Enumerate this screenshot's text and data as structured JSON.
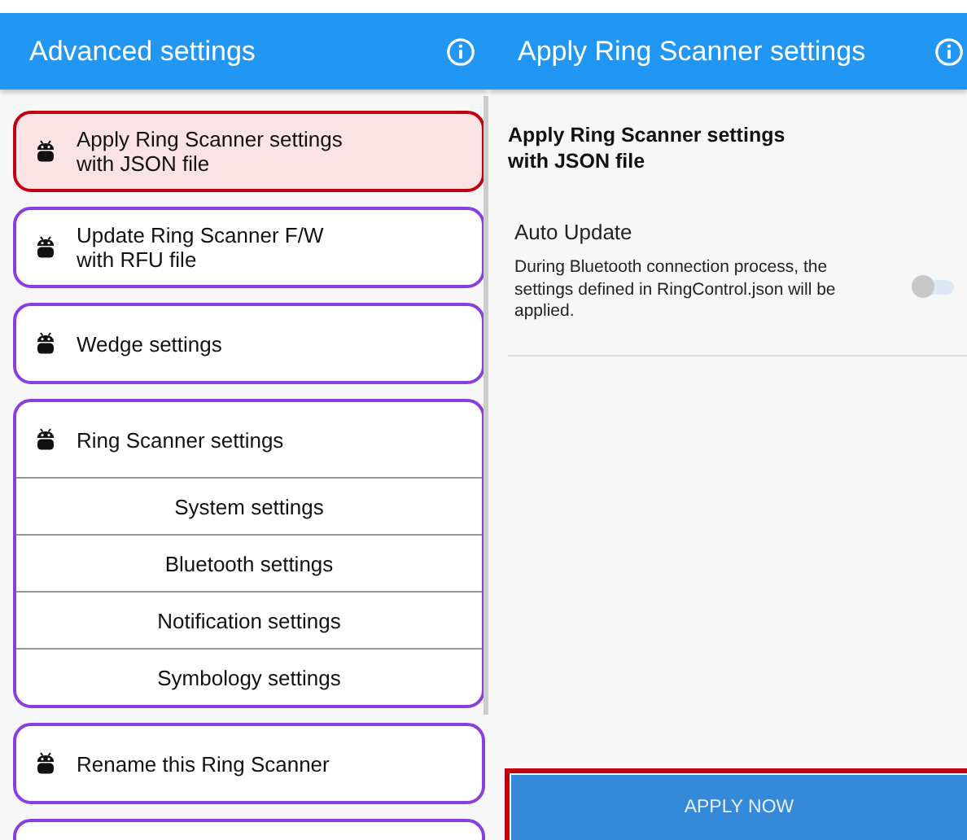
{
  "left_screen": {
    "title": "Advanced settings",
    "items": [
      {
        "kind": "item",
        "label": "Apply Ring Scanner settings\nwith JSON file",
        "selected": true
      },
      {
        "kind": "item",
        "label": "Update Ring Scanner F/W\nwith RFU file",
        "selected": false
      },
      {
        "kind": "item",
        "label": "Wedge settings",
        "selected": false
      },
      {
        "kind": "group",
        "label": "Ring Scanner settings",
        "selected": false,
        "expanded": true,
        "children": [
          "System settings",
          "Bluetooth settings",
          "Notification settings",
          "Symbology settings"
        ]
      },
      {
        "kind": "item",
        "label": "Rename this Ring Scanner",
        "selected": false
      }
    ]
  },
  "right_screen": {
    "title": "Apply Ring Scanner settings",
    "heading": "Apply Ring Scanner settings\nwith JSON file",
    "setting": {
      "label": "Auto Update",
      "description": "During Bluetooth connection process, the settings defined in RingControl.json will be applied.",
      "on": false
    },
    "button": {
      "label": "APPLY NOW",
      "highlighted": true
    }
  }
}
